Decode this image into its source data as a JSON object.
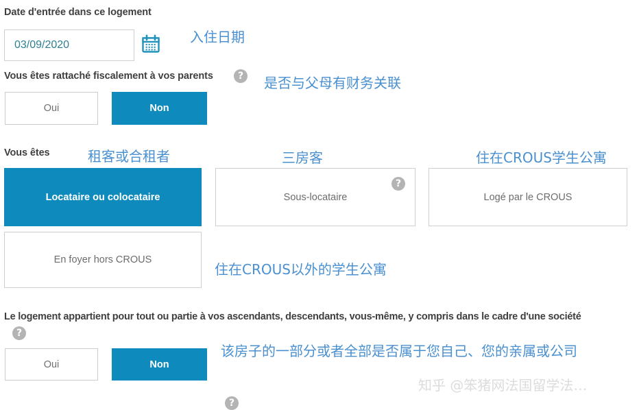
{
  "form": {
    "date_question": {
      "label": "Date d'entrée dans ce logement",
      "value": "03/09/2020",
      "annotation": "入住日期",
      "icon": "calendar-icon"
    },
    "tax_question": {
      "label": "Vous êtes rattaché fiscalement à vos parents",
      "help_icon": "help-icon",
      "annotation": "是否与父母有财务关联",
      "options": [
        {
          "label": "Oui",
          "selected": false
        },
        {
          "label": "Non",
          "selected": true
        }
      ]
    },
    "status_question": {
      "label": "Vous êtes",
      "options": [
        {
          "label": "Locataire ou colocataire",
          "selected": true,
          "annotation": "租客或合租者",
          "help_icon": null
        },
        {
          "label": "Sous-locataire",
          "selected": false,
          "annotation": "三房客",
          "help_icon": "help-icon"
        },
        {
          "label": "Logé par le CROUS",
          "selected": false,
          "annotation": "住在CROUS学生公寓",
          "help_icon": null
        },
        {
          "label": "En foyer hors CROUS",
          "selected": false,
          "annotation": "住在CROUS以外的学生公寓",
          "help_icon": null
        }
      ]
    },
    "ownership_question": {
      "label": "Le logement appartient pour tout ou partie à vos ascendants, descendants, vous-même, y compris dans le cadre d'une société",
      "help_icon": "help-icon",
      "annotation": "该房子的一部分或者全部是否属于您自己、您的亲属或公司",
      "options": [
        {
          "label": "Oui",
          "selected": false
        },
        {
          "label": "Non",
          "selected": true
        }
      ]
    }
  },
  "watermark": {
    "text": "知乎 @笨猪网法国留学法…"
  },
  "colors": {
    "accent_blue": "#0e8bbc",
    "annotation_blue": "#4a90d0",
    "date_text": "#2d7f94",
    "border_gray": "#cfcfcf",
    "help_gray": "#b4b4b4",
    "watermark_gray": "#dcdcdc"
  }
}
